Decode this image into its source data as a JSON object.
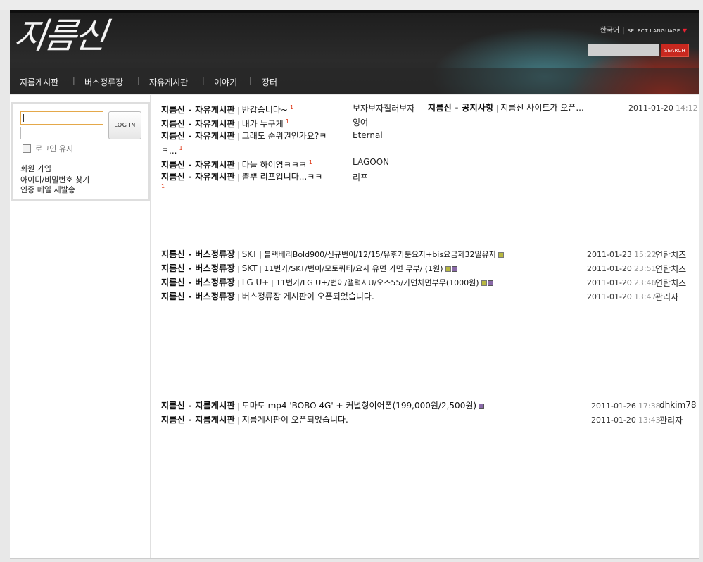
{
  "header": {
    "logo": "지름신",
    "lang_current": "한국어",
    "lang_select": "SELECT LANGUAGE",
    "search_button": "SEARCH"
  },
  "nav": [
    "지름게시판",
    "버스정류장",
    "자유게시판",
    "이야기",
    "장터"
  ],
  "login": {
    "button": "LOG IN",
    "keep": "로그인 유지",
    "links": [
      "회원 가입",
      "아이디/비밀번호 찾기",
      "인증 메일 재발송"
    ]
  },
  "free_board": {
    "items": [
      {
        "board": "지름신 - 자유게시판",
        "title": "반갑습니다~",
        "count": "1",
        "author": "보자보자질러보자"
      },
      {
        "board": "지름신 - 자유게시판",
        "title": "내가 누구게",
        "count": "1",
        "author": "잉여"
      },
      {
        "board": "지름신 - 자유게시판",
        "title": "그래도 순위권인가요?ㅋ",
        "title_cont": "ㅋ...",
        "count": "1",
        "author": "Eternal"
      },
      {
        "board": "지름신 - 자유게시판",
        "title": "다들 하이염ㅋㅋㅋ",
        "count": "1",
        "author": "LAGOON"
      },
      {
        "board": "지름신 - 자유게시판",
        "title": "뽐뿌 리프입니다...ㅋㅋ",
        "count": "1",
        "author": "리프"
      }
    ]
  },
  "notice": {
    "board": "지름신 - 공지사항",
    "title": "지름신 사이트가 오픈...",
    "date": "2011-01-20",
    "time": "14:12"
  },
  "bus_board": {
    "items": [
      {
        "board": "지름신 - 버스정류장",
        "tag": "SKT",
        "title": "블랙베리Bold900/신규번이/12/15/유후가분요자+bis요금제32일유지",
        "date": "2011-01-23",
        "time": "15:22",
        "author": "연탄치즈",
        "icons": [
          "img"
        ]
      },
      {
        "board": "지름신 - 버스정류장",
        "tag": "SKT",
        "title": "11번가/SKT/번이/모토쿼티/요자 유면 가면 무부/ (1원)",
        "date": "2011-01-20",
        "time": "23:51",
        "author": "연탄치즈",
        "icons": [
          "img",
          "file"
        ]
      },
      {
        "board": "지름신 - 버스정류장",
        "tag": "LG U+",
        "title": "11번가/LG U+/번이/갤럭시U/오즈55/가면채면부무(1000원)",
        "date": "2011-01-20",
        "time": "23:46",
        "author": "연탄치즈",
        "icons": [
          "img",
          "file"
        ]
      },
      {
        "board": "지름신 - 버스정류장",
        "tag": "",
        "title": "버스정류장 게시판이 오픈되었습니다.",
        "date": "2011-01-20",
        "time": "13:47",
        "author": "관리자",
        "icons": []
      }
    ]
  },
  "buy_board": {
    "items": [
      {
        "board": "지름신 - 지름게시판",
        "title": "토마토 mp4 'BOBO 4G' + 커널형이어폰(199,000원/2,500원)",
        "date": "2011-01-26",
        "time": "17:38",
        "author": "dhkim78",
        "icons": [
          "file"
        ]
      },
      {
        "board": "지름신 - 지름게시판",
        "title": "지름게시판이 오픈되었습니다.",
        "date": "2011-01-20",
        "time": "13:43",
        "author": "관리자",
        "icons": []
      }
    ]
  },
  "colors": {
    "accent": "#c8281f",
    "header_bg": "#222222",
    "comment_count": "#dd3311"
  }
}
